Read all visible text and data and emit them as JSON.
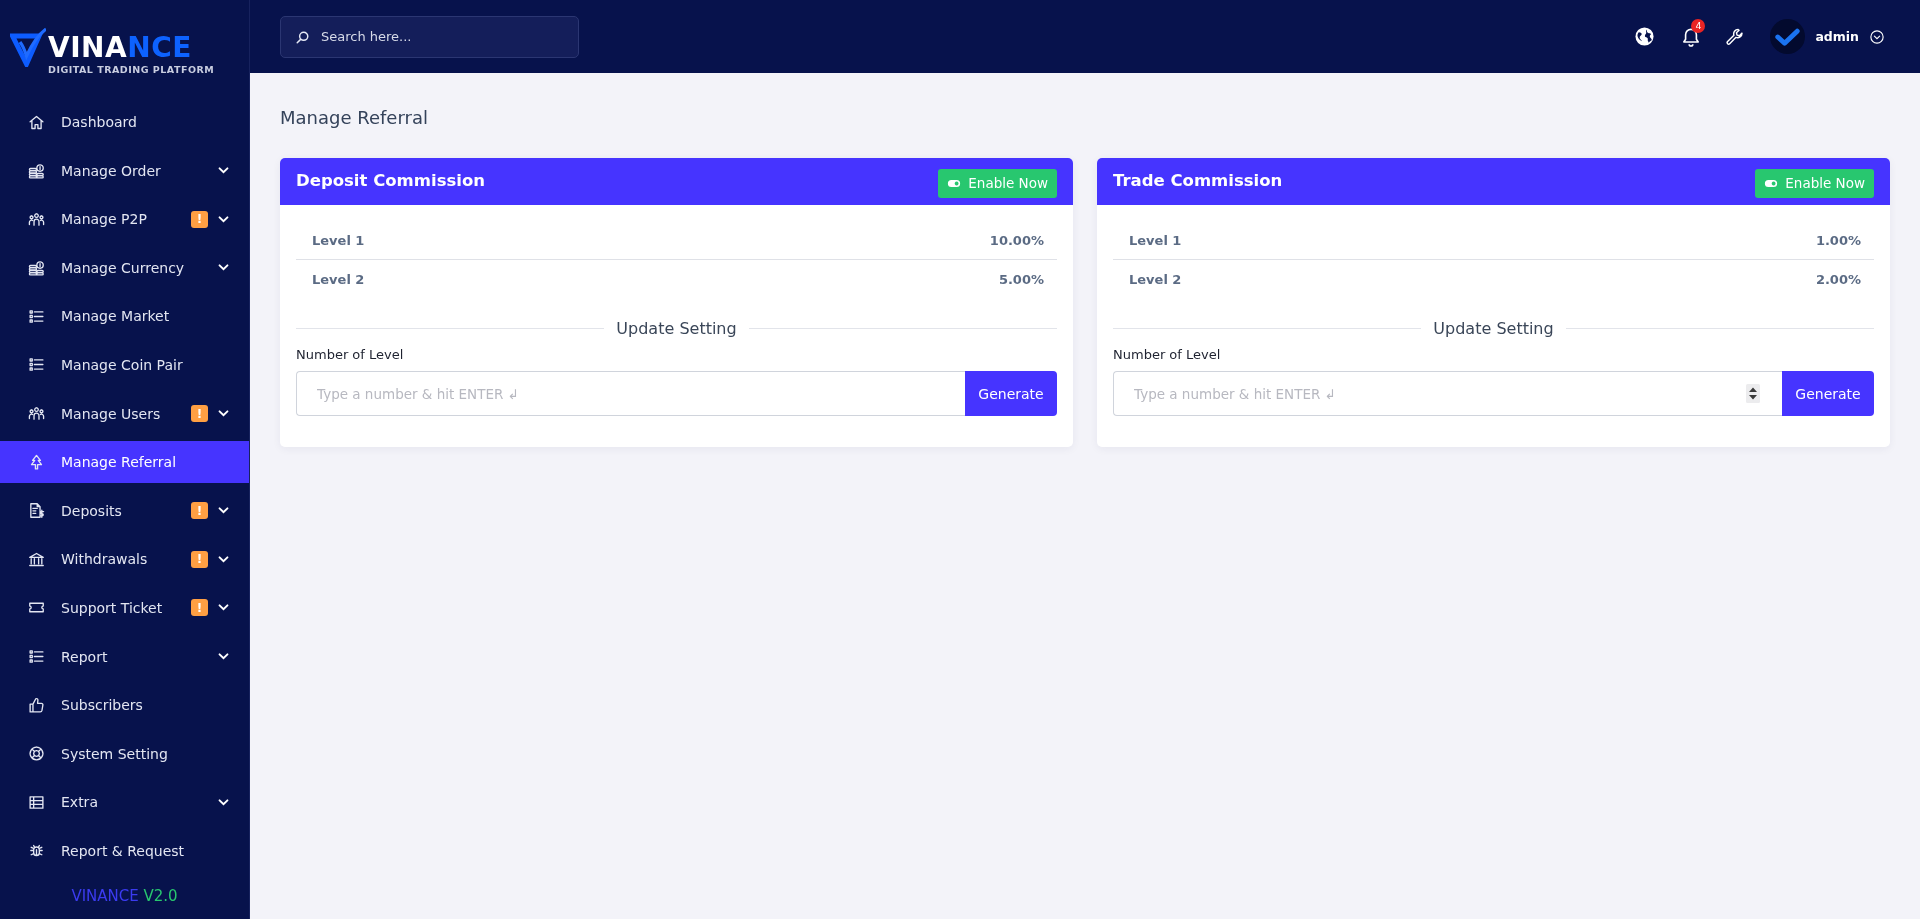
{
  "sidebar": {
    "logo": {
      "wordmark_parts": [
        "VINA",
        "NCE"
      ],
      "tagline": "DIGITAL TRADING PLATFORM"
    },
    "items": [
      {
        "label": "Dashboard",
        "selected": false,
        "has_submenu": false
      },
      {
        "label": "Manage Order",
        "selected": false,
        "has_submenu": true
      },
      {
        "label": "Manage P2P",
        "selected": false,
        "badge": "!",
        "has_submenu": true
      },
      {
        "label": "Manage Currency",
        "selected": false,
        "has_submenu": true
      },
      {
        "label": "Manage Market",
        "selected": false,
        "has_submenu": false
      },
      {
        "label": "Manage Coin Pair",
        "selected": false,
        "has_submenu": false
      },
      {
        "label": "Manage Users",
        "selected": false,
        "badge": "!",
        "has_submenu": true
      },
      {
        "label": "Manage Referral",
        "selected": true,
        "has_submenu": false
      },
      {
        "label": "Deposits",
        "selected": false,
        "badge": "!",
        "has_submenu": true
      },
      {
        "label": "Withdrawals",
        "selected": false,
        "badge": "!",
        "has_submenu": true
      },
      {
        "label": "Support Ticket",
        "selected": false,
        "badge": "!",
        "has_submenu": true
      },
      {
        "label": "Report",
        "selected": false,
        "has_submenu": true
      },
      {
        "label": "Subscribers",
        "selected": false,
        "has_submenu": false
      },
      {
        "label": "System Setting",
        "selected": false,
        "has_submenu": false
      },
      {
        "label": "Extra",
        "selected": false,
        "has_submenu": true
      },
      {
        "label": "Report & Request",
        "selected": false,
        "has_submenu": false
      }
    ],
    "footer": {
      "brand": "VINANCE",
      "version": "V2.0"
    }
  },
  "topbar": {
    "search": {
      "placeholder": "Search here..."
    },
    "notification_count": "4",
    "user": {
      "name": "admin"
    }
  },
  "page": {
    "title": "Manage Referral"
  },
  "cards": [
    {
      "title": "Deposit Commission",
      "enable_button": "Enable Now",
      "levels": [
        {
          "label": "Level 1",
          "value": "10.00%"
        },
        {
          "label": "Level 2",
          "value": "5.00%"
        }
      ],
      "divider_label": "Update Setting",
      "field_label": "Number of Level",
      "field": {
        "placeholder": "Type a number & hit ENTER ↲",
        "hovered": false
      },
      "button": "Generate"
    },
    {
      "title": "Trade Commission",
      "enable_button": "Enable Now",
      "levels": [
        {
          "label": "Level 1",
          "value": "1.00%"
        },
        {
          "label": "Level 2",
          "value": "2.00%"
        }
      ],
      "divider_label": "Update Setting",
      "field_label": "Number of Level",
      "field": {
        "placeholder": "Type a number & hit ENTER ↲",
        "hovered": true
      },
      "button": "Generate"
    }
  ]
}
